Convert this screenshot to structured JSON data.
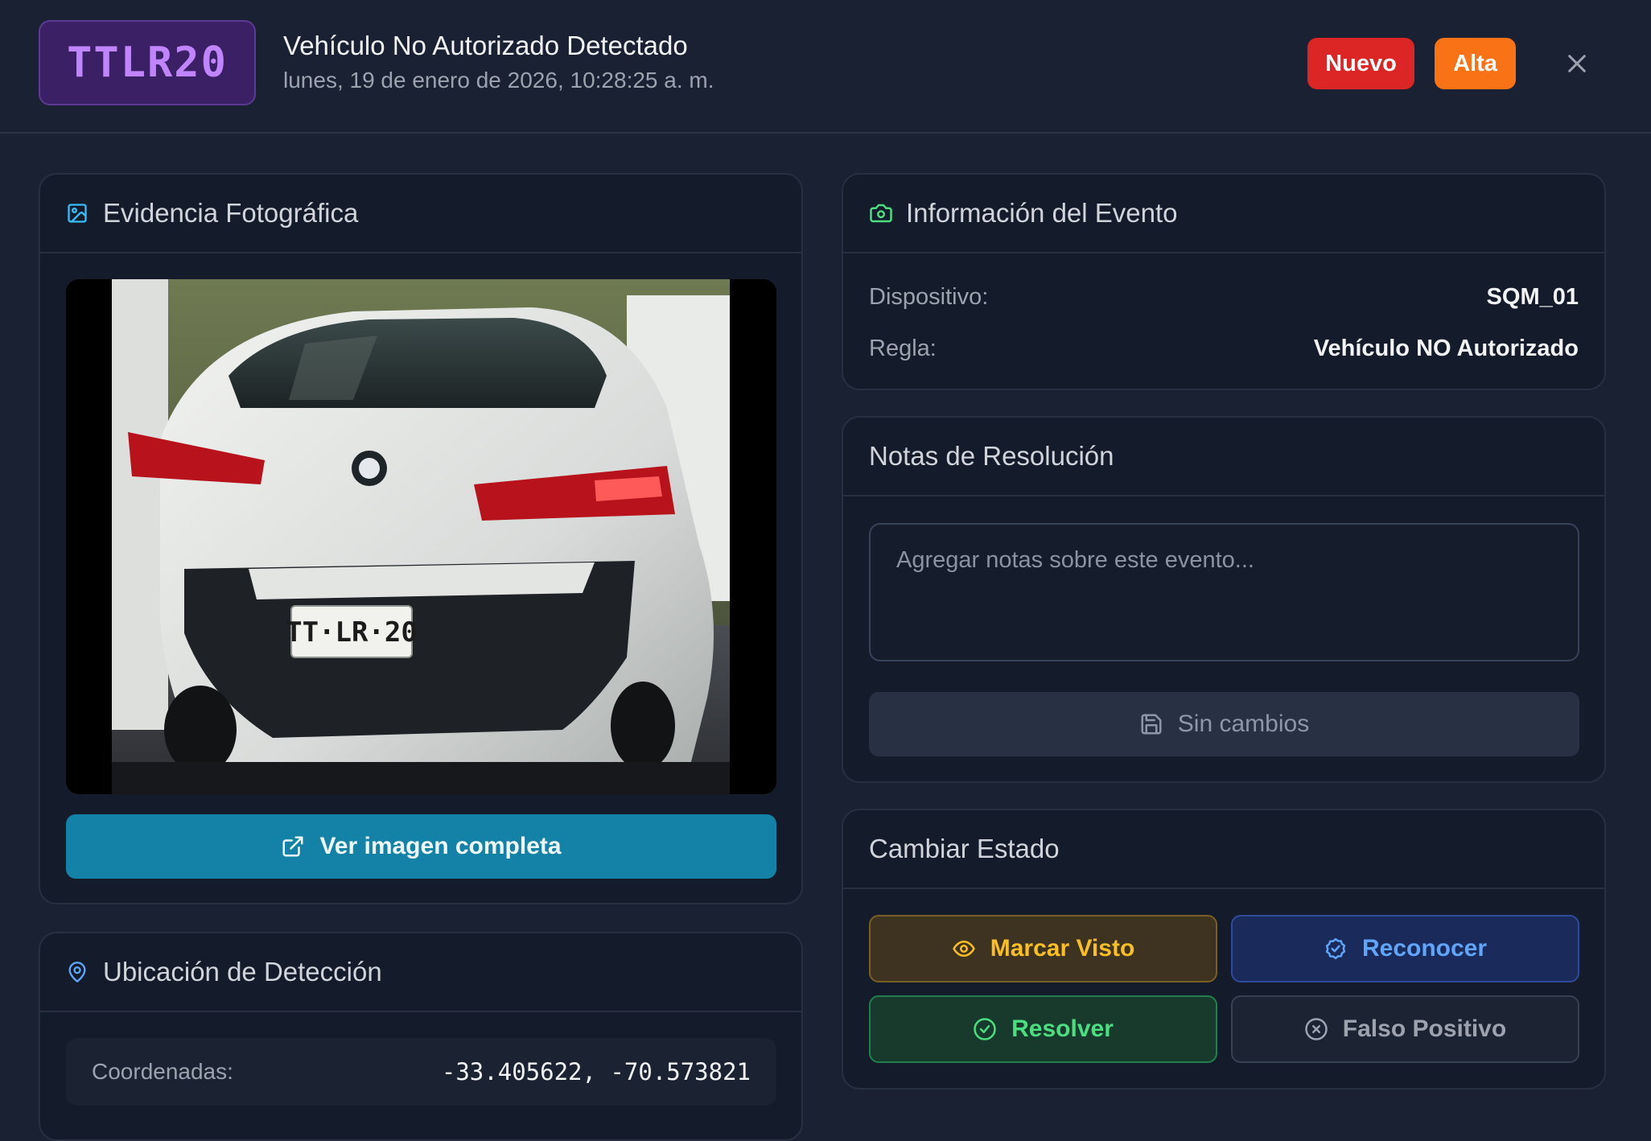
{
  "header": {
    "plate": "TTLR20",
    "title": "Vehículo No Autorizado Detectado",
    "timestamp": "lunes, 19 de enero de 2026, 10:28:25 a. m.",
    "status_badge": "Nuevo",
    "priority_badge": "Alta",
    "close_icon": "close-icon"
  },
  "photo": {
    "title": "Evidencia Fotográfica",
    "icon": "image-icon",
    "image_plate_text": "TT·LR·20",
    "view_button": "Ver imagen completa",
    "view_icon": "external-link-icon"
  },
  "location": {
    "title": "Ubicación de Detección",
    "icon": "map-pin-icon",
    "coords_label": "Coordenadas:",
    "coords_value": "-33.405622, -70.573821"
  },
  "event_info": {
    "title": "Información del Evento",
    "icon": "camera-icon",
    "rows": [
      {
        "label": "Dispositivo:",
        "value": "SQM_01"
      },
      {
        "label": "Regla:",
        "value": "Vehículo NO Autorizado"
      }
    ]
  },
  "notes": {
    "title": "Notas de Resolución",
    "placeholder": "Agregar notas sobre este evento...",
    "save_button": "Sin cambios",
    "save_icon": "save-icon"
  },
  "state": {
    "title": "Cambiar Estado",
    "buttons": {
      "mark_seen": "Marcar Visto",
      "acknowledge": "Reconocer",
      "resolve": "Resolver",
      "false_positive": "Falso Positivo"
    }
  },
  "colors": {
    "background": "#1a2132",
    "card": "#141b2a",
    "plate_purple": "#c084fc",
    "badge_new": "#dc2626",
    "badge_high": "#f97316",
    "primary_button": "#1481a6",
    "seen_yellow": "#fbbf24",
    "acknowledge_blue": "#60a5fa",
    "resolve_green": "#4ade80"
  }
}
